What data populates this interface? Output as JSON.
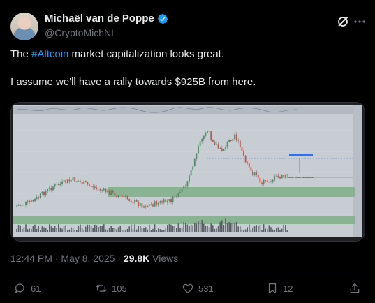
{
  "author": {
    "display_name": "Michaël van de Poppe",
    "handle": "@CryptoMichNL",
    "verified": true
  },
  "header_icons": [
    "grok-icon",
    "more-icon"
  ],
  "tweet": {
    "text_before": "The ",
    "hashtag": "#Altcoin",
    "text_after": " market capitalization looks great.",
    "line2": "I assume we'll have a rally towards $925B from here."
  },
  "chart_image": {
    "annotation_label": "Altcoin market capitalization",
    "colors": {
      "background": "#c8ccd3",
      "candle_up": "#4e8a63",
      "candle_down": "#b5574d",
      "zone": "#7fae88",
      "target_line": "#3a6fd8"
    }
  },
  "meta": {
    "time": "12:44 PM",
    "separator": " · ",
    "date": "May 8, 2025",
    "views_count": "29.8K",
    "views_label": " Views"
  },
  "actions": {
    "replies": "61",
    "reposts": "105",
    "likes": "531",
    "bookmarks": "12"
  },
  "colors": {
    "background": "#000000",
    "text": "#e7e9ea",
    "muted": "#71767b",
    "accent": "#1d9bf0"
  }
}
